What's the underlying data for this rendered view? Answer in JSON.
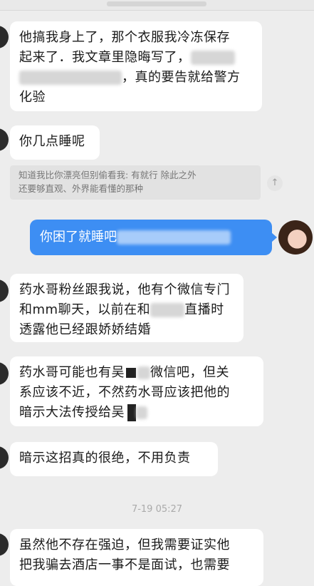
{
  "messages": {
    "m1_line1": "他搞我身上了，那个衣服我冷冻保存",
    "m1_line2a": "起来了．我文章里隐晦写了，",
    "m1_line3b": "，真的要告就给警方",
    "m1_line4": "化验",
    "m2": "你几点睡呢",
    "quote_line1": "知道我比你漂亮但别偷看我: 有就行 除此之外",
    "quote_line2": "还要够直观、外界能看懂的那种",
    "m3_sent": "你困了就睡吧",
    "m4_line1": "药水哥粉丝跟我说，他有个微信专门",
    "m4_line2a": "和mm聊天，以前在和",
    "m4_line2b": "直播时",
    "m4_line3": "透露他已经跟娇娇结婚",
    "m5_line1a": "药水哥可能也有吴",
    "m5_line1b": "微信吧，但关",
    "m5_line2": "系应该不近，不然药水哥应该把他的",
    "m5_line3a": "暗示大法传授给吴",
    "m6": "暗示这招真的很绝，不用负责",
    "timestamp": "7-19 05:27",
    "m7_line1": "虽然他不存在强迫，但我需要证实他",
    "m7_line2": "把我骗去酒店一事不是面试，也需要"
  },
  "icons": {
    "quote_action": "↑"
  },
  "colors": {
    "background": "#ededed",
    "incoming_bubble": "#ffffff",
    "outgoing_bubble": "#3d8ef3"
  }
}
